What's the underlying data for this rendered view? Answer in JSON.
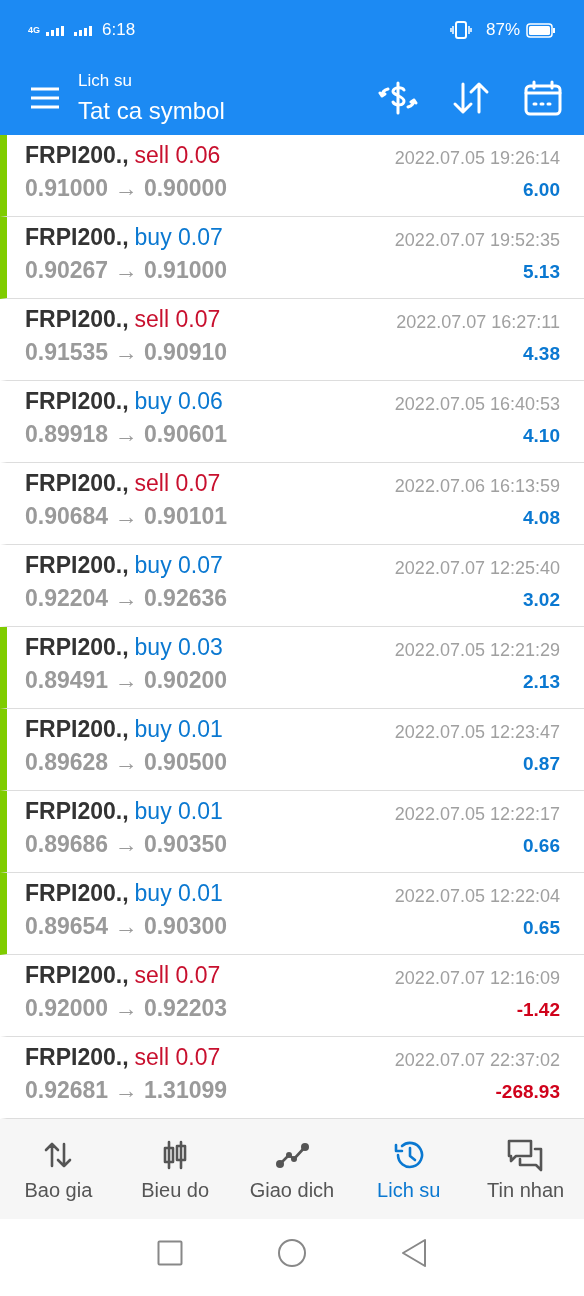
{
  "status_bar": {
    "network": "4G",
    "time": "6:18",
    "battery": "87%"
  },
  "header": {
    "subtitle": "Lich su",
    "title": "Tat ca symbol"
  },
  "trades": [
    {
      "symbol": "FRPI200.,",
      "kind": "sell",
      "trade": "sell 0.06",
      "prices": "0.91000 → 0.90000",
      "time": "2022.07.05 19:26:14",
      "profit": "6.00",
      "loss": false,
      "marked": true
    },
    {
      "symbol": "FRPI200.,",
      "kind": "buy",
      "trade": "buy 0.07",
      "prices": "0.90267 → 0.91000",
      "time": "2022.07.07 19:52:35",
      "profit": "5.13",
      "loss": false,
      "marked": true
    },
    {
      "symbol": "FRPI200.,",
      "kind": "sell",
      "trade": "sell 0.07",
      "prices": "0.91535 → 0.90910",
      "time": "2022.07.07 16:27:11",
      "profit": "4.38",
      "loss": false,
      "marked": false
    },
    {
      "symbol": "FRPI200.,",
      "kind": "buy",
      "trade": "buy 0.06",
      "prices": "0.89918 → 0.90601",
      "time": "2022.07.05 16:40:53",
      "profit": "4.10",
      "loss": false,
      "marked": false
    },
    {
      "symbol": "FRPI200.,",
      "kind": "sell",
      "trade": "sell 0.07",
      "prices": "0.90684 → 0.90101",
      "time": "2022.07.06 16:13:59",
      "profit": "4.08",
      "loss": false,
      "marked": false
    },
    {
      "symbol": "FRPI200.,",
      "kind": "buy",
      "trade": "buy 0.07",
      "prices": "0.92204 → 0.92636",
      "time": "2022.07.07 12:25:40",
      "profit": "3.02",
      "loss": false,
      "marked": false
    },
    {
      "symbol": "FRPI200.,",
      "kind": "buy",
      "trade": "buy 0.03",
      "prices": "0.89491 → 0.90200",
      "time": "2022.07.05 12:21:29",
      "profit": "2.13",
      "loss": false,
      "marked": true
    },
    {
      "symbol": "FRPI200.,",
      "kind": "buy",
      "trade": "buy 0.01",
      "prices": "0.89628 → 0.90500",
      "time": "2022.07.05 12:23:47",
      "profit": "0.87",
      "loss": false,
      "marked": true
    },
    {
      "symbol": "FRPI200.,",
      "kind": "buy",
      "trade": "buy 0.01",
      "prices": "0.89686 → 0.90350",
      "time": "2022.07.05 12:22:17",
      "profit": "0.66",
      "loss": false,
      "marked": true
    },
    {
      "symbol": "FRPI200.,",
      "kind": "buy",
      "trade": "buy 0.01",
      "prices": "0.89654 → 0.90300",
      "time": "2022.07.05 12:22:04",
      "profit": "0.65",
      "loss": false,
      "marked": true
    },
    {
      "symbol": "FRPI200.,",
      "kind": "sell",
      "trade": "sell 0.07",
      "prices": "0.92000 → 0.92203",
      "time": "2022.07.07 12:16:09",
      "profit": "-1.42",
      "loss": true,
      "marked": false
    },
    {
      "symbol": "FRPI200.,",
      "kind": "sell",
      "trade": "sell 0.07",
      "prices": "0.92681 → 1.31099",
      "time": "2022.07.07 22:37:02",
      "profit": "-268.93",
      "loss": true,
      "marked": false
    }
  ],
  "bottom_nav": [
    {
      "kind": "quotes",
      "label": "Bao gia",
      "selected": false
    },
    {
      "kind": "chart",
      "label": "Bieu do",
      "selected": false
    },
    {
      "kind": "trade",
      "label": "Giao dich",
      "selected": false
    },
    {
      "kind": "history",
      "label": "Lich su",
      "selected": true
    },
    {
      "kind": "messages",
      "label": "Tin nhan",
      "selected": false
    }
  ]
}
